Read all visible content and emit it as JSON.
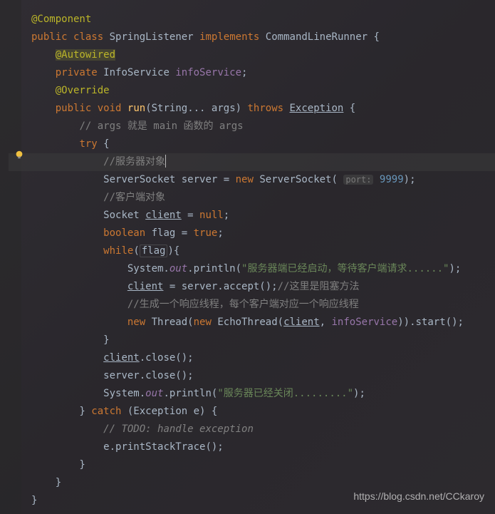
{
  "code": {
    "l1_annotation": "@Component",
    "l2_public": "public",
    "l2_class": "class",
    "l2_name": "SpringListener",
    "l2_implements": "implements",
    "l2_interface": "CommandLineRunner",
    "l3_autowired": "@Autowired",
    "l4_private": "private",
    "l4_type": "InfoService",
    "l4_field": "infoService",
    "l5_override": "@Override",
    "l6_public": "public",
    "l6_void": "void",
    "l6_run": "run",
    "l6_params": "(String... args)",
    "l6_throws": "throws",
    "l6_exception": "Exception",
    "l7_comment": "// args 就是 main 函数的 args",
    "l8_try": "try",
    "l9_comment": "//服务器对象",
    "l10_type": "ServerSocket server =",
    "l10_new": "new",
    "l10_ctor": "ServerSocket(",
    "l10_hint": "port:",
    "l10_port": "9999",
    "l11_comment": "//客户端对象",
    "l12_type": "Socket",
    "l12_var": "client",
    "l12_eq": " = ",
    "l12_null": "null",
    "l13_boolean": "boolean",
    "l13_var": "flag =",
    "l13_true": "true",
    "l14_while": "while",
    "l14_flag": "flag",
    "l15_sys": "System.",
    "l15_out": "out",
    "l15_println": ".println(",
    "l15_str": "\"服务器端已经启动，等待客户端请求......\"",
    "l16_client": "client",
    "l16_accept": " = server.accept();",
    "l16_comment": "//这里是阻塞方法",
    "l17_comment": "//生成一个响应线程，每个客户端对应一个响应线程",
    "l18_new1": "new",
    "l18_thread": "Thread(",
    "l18_new2": "new",
    "l18_echo": "EchoThread(",
    "l18_client": "client",
    "l18_info": "infoService",
    "l18_start": ")).start();",
    "l19_close_client": "client",
    "l19_close": ".close();",
    "l20_server_close": "server.close();",
    "l21_sys": "System.",
    "l21_out": "out",
    "l21_println": ".println(",
    "l21_str": "\"服务器已经关闭.........\"",
    "l22_catch": "catch",
    "l22_param": "(Exception e)",
    "l23_todo": "// TODO: handle exception",
    "l24_trace": "e.printStackTrace();"
  },
  "watermark": "https://blog.csdn.net/CCkaroy"
}
